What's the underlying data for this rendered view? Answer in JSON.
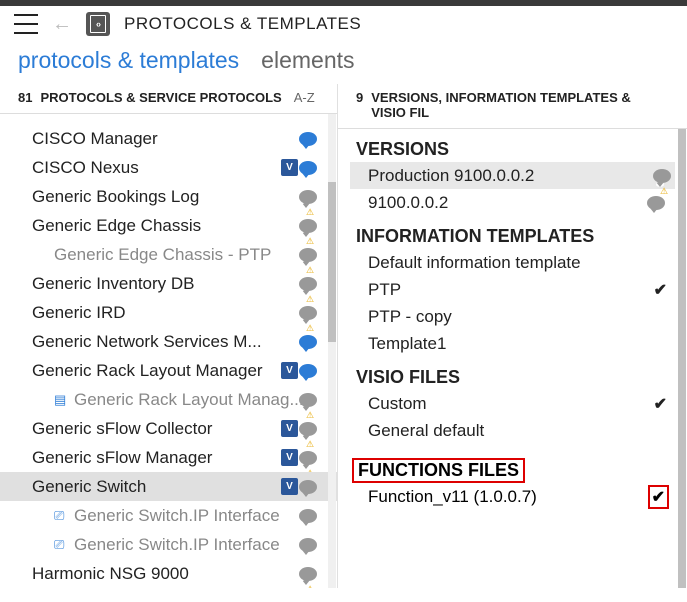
{
  "header": {
    "title": "PROTOCOLS & TEMPLATES"
  },
  "tabs": {
    "active": "protocols & templates",
    "other": "elements"
  },
  "left": {
    "count": "81",
    "title": "PROTOCOLS & SERVICE PROTOCOLS",
    "sort": "A-Z",
    "items": [
      {
        "label": "CISCO Manager",
        "icons": [
          "bubble-blue"
        ]
      },
      {
        "label": "CISCO Nexus",
        "icons": [
          "visio",
          "bubble-blue"
        ]
      },
      {
        "label": "Generic Bookings Log",
        "icons": [
          "bubble-grey-warn"
        ]
      },
      {
        "label": "Generic Edge Chassis",
        "icons": [
          "bubble-grey-warn"
        ]
      },
      {
        "label": "Generic Edge Chassis - PTP",
        "child": true,
        "icons": [
          "bubble-grey-warn"
        ]
      },
      {
        "label": "Generic Inventory DB",
        "icons": [
          "bubble-grey-warn"
        ]
      },
      {
        "label": "Generic IRD",
        "icons": [
          "bubble-grey-warn"
        ]
      },
      {
        "label": "Generic Network Services M...",
        "icons": [
          "bubble-blue"
        ]
      },
      {
        "label": "Generic Rack Layout Manager",
        "icons": [
          "visio",
          "bubble-blue"
        ]
      },
      {
        "label": "Generic Rack Layout Manag...",
        "child": true,
        "tree": "layout",
        "icons": [
          "bubble-grey-warn"
        ]
      },
      {
        "label": "Generic sFlow Collector",
        "icons": [
          "visio",
          "bubble-grey-warn"
        ]
      },
      {
        "label": "Generic sFlow Manager",
        "icons": [
          "visio",
          "bubble-grey-warn"
        ]
      },
      {
        "label": "Generic Switch",
        "selected": true,
        "icons": [
          "visio",
          "bubble-grey"
        ]
      },
      {
        "label": "Generic Switch.IP Interface",
        "child": true,
        "tree": "net",
        "icons": [
          "bubble-grey"
        ]
      },
      {
        "label": "Generic Switch.IP Interface",
        "child": true,
        "tree": "net",
        "icons": [
          "bubble-grey"
        ]
      },
      {
        "label": "Harmonic NSG 9000",
        "icons": [
          "bubble-grey-warn"
        ]
      }
    ]
  },
  "right": {
    "count": "9",
    "title": "VERSIONS, INFORMATION TEMPLATES & VISIO FIL",
    "versions": {
      "title": "VERSIONS",
      "items": [
        {
          "label": "Production 9100.0.0.2",
          "sel": true,
          "warn": true
        },
        {
          "label": "9100.0.0.2"
        }
      ]
    },
    "info": {
      "title": "INFORMATION TEMPLATES",
      "items": [
        {
          "label": "Default information template"
        },
        {
          "label": "PTP",
          "check": true
        },
        {
          "label": "PTP - copy"
        },
        {
          "label": "Template1"
        }
      ]
    },
    "visio": {
      "title": "VISIO FILES",
      "items": [
        {
          "label": "Custom",
          "check": true
        },
        {
          "label": "General default"
        }
      ]
    },
    "functions": {
      "title": "FUNCTIONS FILES",
      "items": [
        {
          "label": "Function_v11 (1.0.0.7)",
          "check": true
        }
      ]
    }
  }
}
